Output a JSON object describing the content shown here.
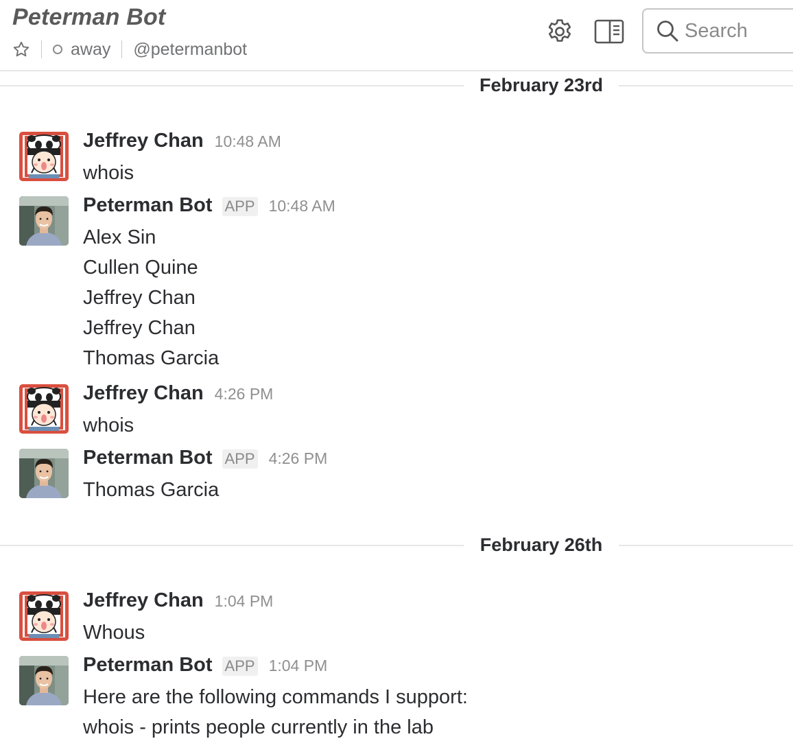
{
  "header": {
    "title": "Peterman Bot",
    "status": "away",
    "handle": "@petermanbot",
    "search_placeholder": "Search"
  },
  "dates": [
    "February 23rd",
    "February 26th"
  ],
  "messages": [
    {
      "sender": "Jeffrey Chan",
      "badge": "",
      "time": "10:48 AM",
      "lines": [
        "whois"
      ]
    },
    {
      "sender": "Peterman Bot",
      "badge": "APP",
      "time": "10:48 AM",
      "lines": [
        "Alex Sin",
        "Cullen Quine",
        "Jeffrey Chan",
        "Jeffrey Chan",
        "Thomas Garcia"
      ]
    },
    {
      "sender": "Jeffrey Chan",
      "badge": "",
      "time": "4:26 PM",
      "lines": [
        "whois"
      ]
    },
    {
      "sender": "Peterman Bot",
      "badge": "APP",
      "time": "4:26 PM",
      "lines": [
        "Thomas Garcia"
      ]
    },
    {
      "sender": "Jeffrey Chan",
      "badge": "",
      "time": "1:04 PM",
      "lines": [
        "Whous"
      ]
    },
    {
      "sender": "Peterman Bot",
      "badge": "APP",
      "time": "1:04 PM",
      "lines": [
        "Here are the following commands I support:",
        "whois - prints people currently in the lab"
      ]
    }
  ],
  "icons": {
    "star": "star-icon",
    "status": "status-dot-icon",
    "settings": "gear-icon",
    "details": "sidebar-panel-icon",
    "search": "search-icon"
  },
  "colors": {
    "text": "#2c2d30",
    "muted": "#717274",
    "divider": "#e6e6e6",
    "panda_frame": "#d94f3f"
  }
}
